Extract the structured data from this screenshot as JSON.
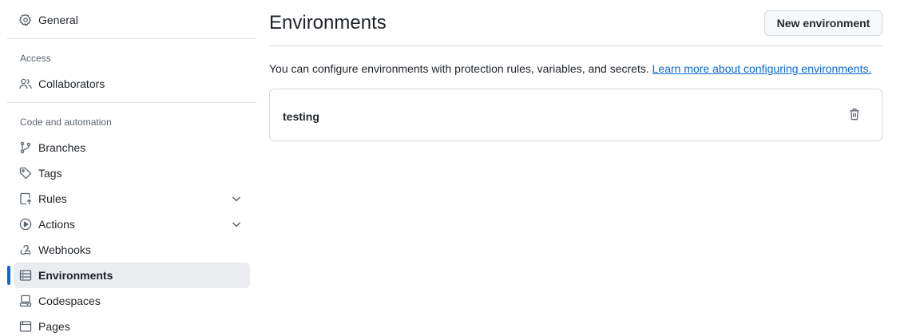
{
  "sidebar": {
    "general": {
      "label": "General",
      "icon": "gear-icon"
    },
    "access": {
      "heading": "Access",
      "items": [
        {
          "label": "Collaborators",
          "icon": "people-icon"
        }
      ]
    },
    "code_automation": {
      "heading": "Code and automation",
      "items": [
        {
          "label": "Branches",
          "icon": "git-branch-icon"
        },
        {
          "label": "Tags",
          "icon": "tag-icon"
        },
        {
          "label": "Rules",
          "icon": "repo-push-icon",
          "expandable": true
        },
        {
          "label": "Actions",
          "icon": "play-icon",
          "expandable": true
        },
        {
          "label": "Webhooks",
          "icon": "webhook-icon"
        },
        {
          "label": "Environments",
          "icon": "server-icon",
          "active": true
        },
        {
          "label": "Codespaces",
          "icon": "codespaces-icon"
        },
        {
          "label": "Pages",
          "icon": "browser-icon"
        }
      ]
    }
  },
  "main": {
    "title": "Environments",
    "new_button": "New environment",
    "description": "You can configure environments with protection rules, variables, and secrets.",
    "learn_more": "Learn more about configuring environments.",
    "environments": [
      {
        "name": "testing"
      }
    ]
  },
  "colors": {
    "accent": "#0969da",
    "active_bg": "#eaecef",
    "border": "#d1d9e0",
    "text": "#1f2328",
    "muted": "#59636e"
  }
}
